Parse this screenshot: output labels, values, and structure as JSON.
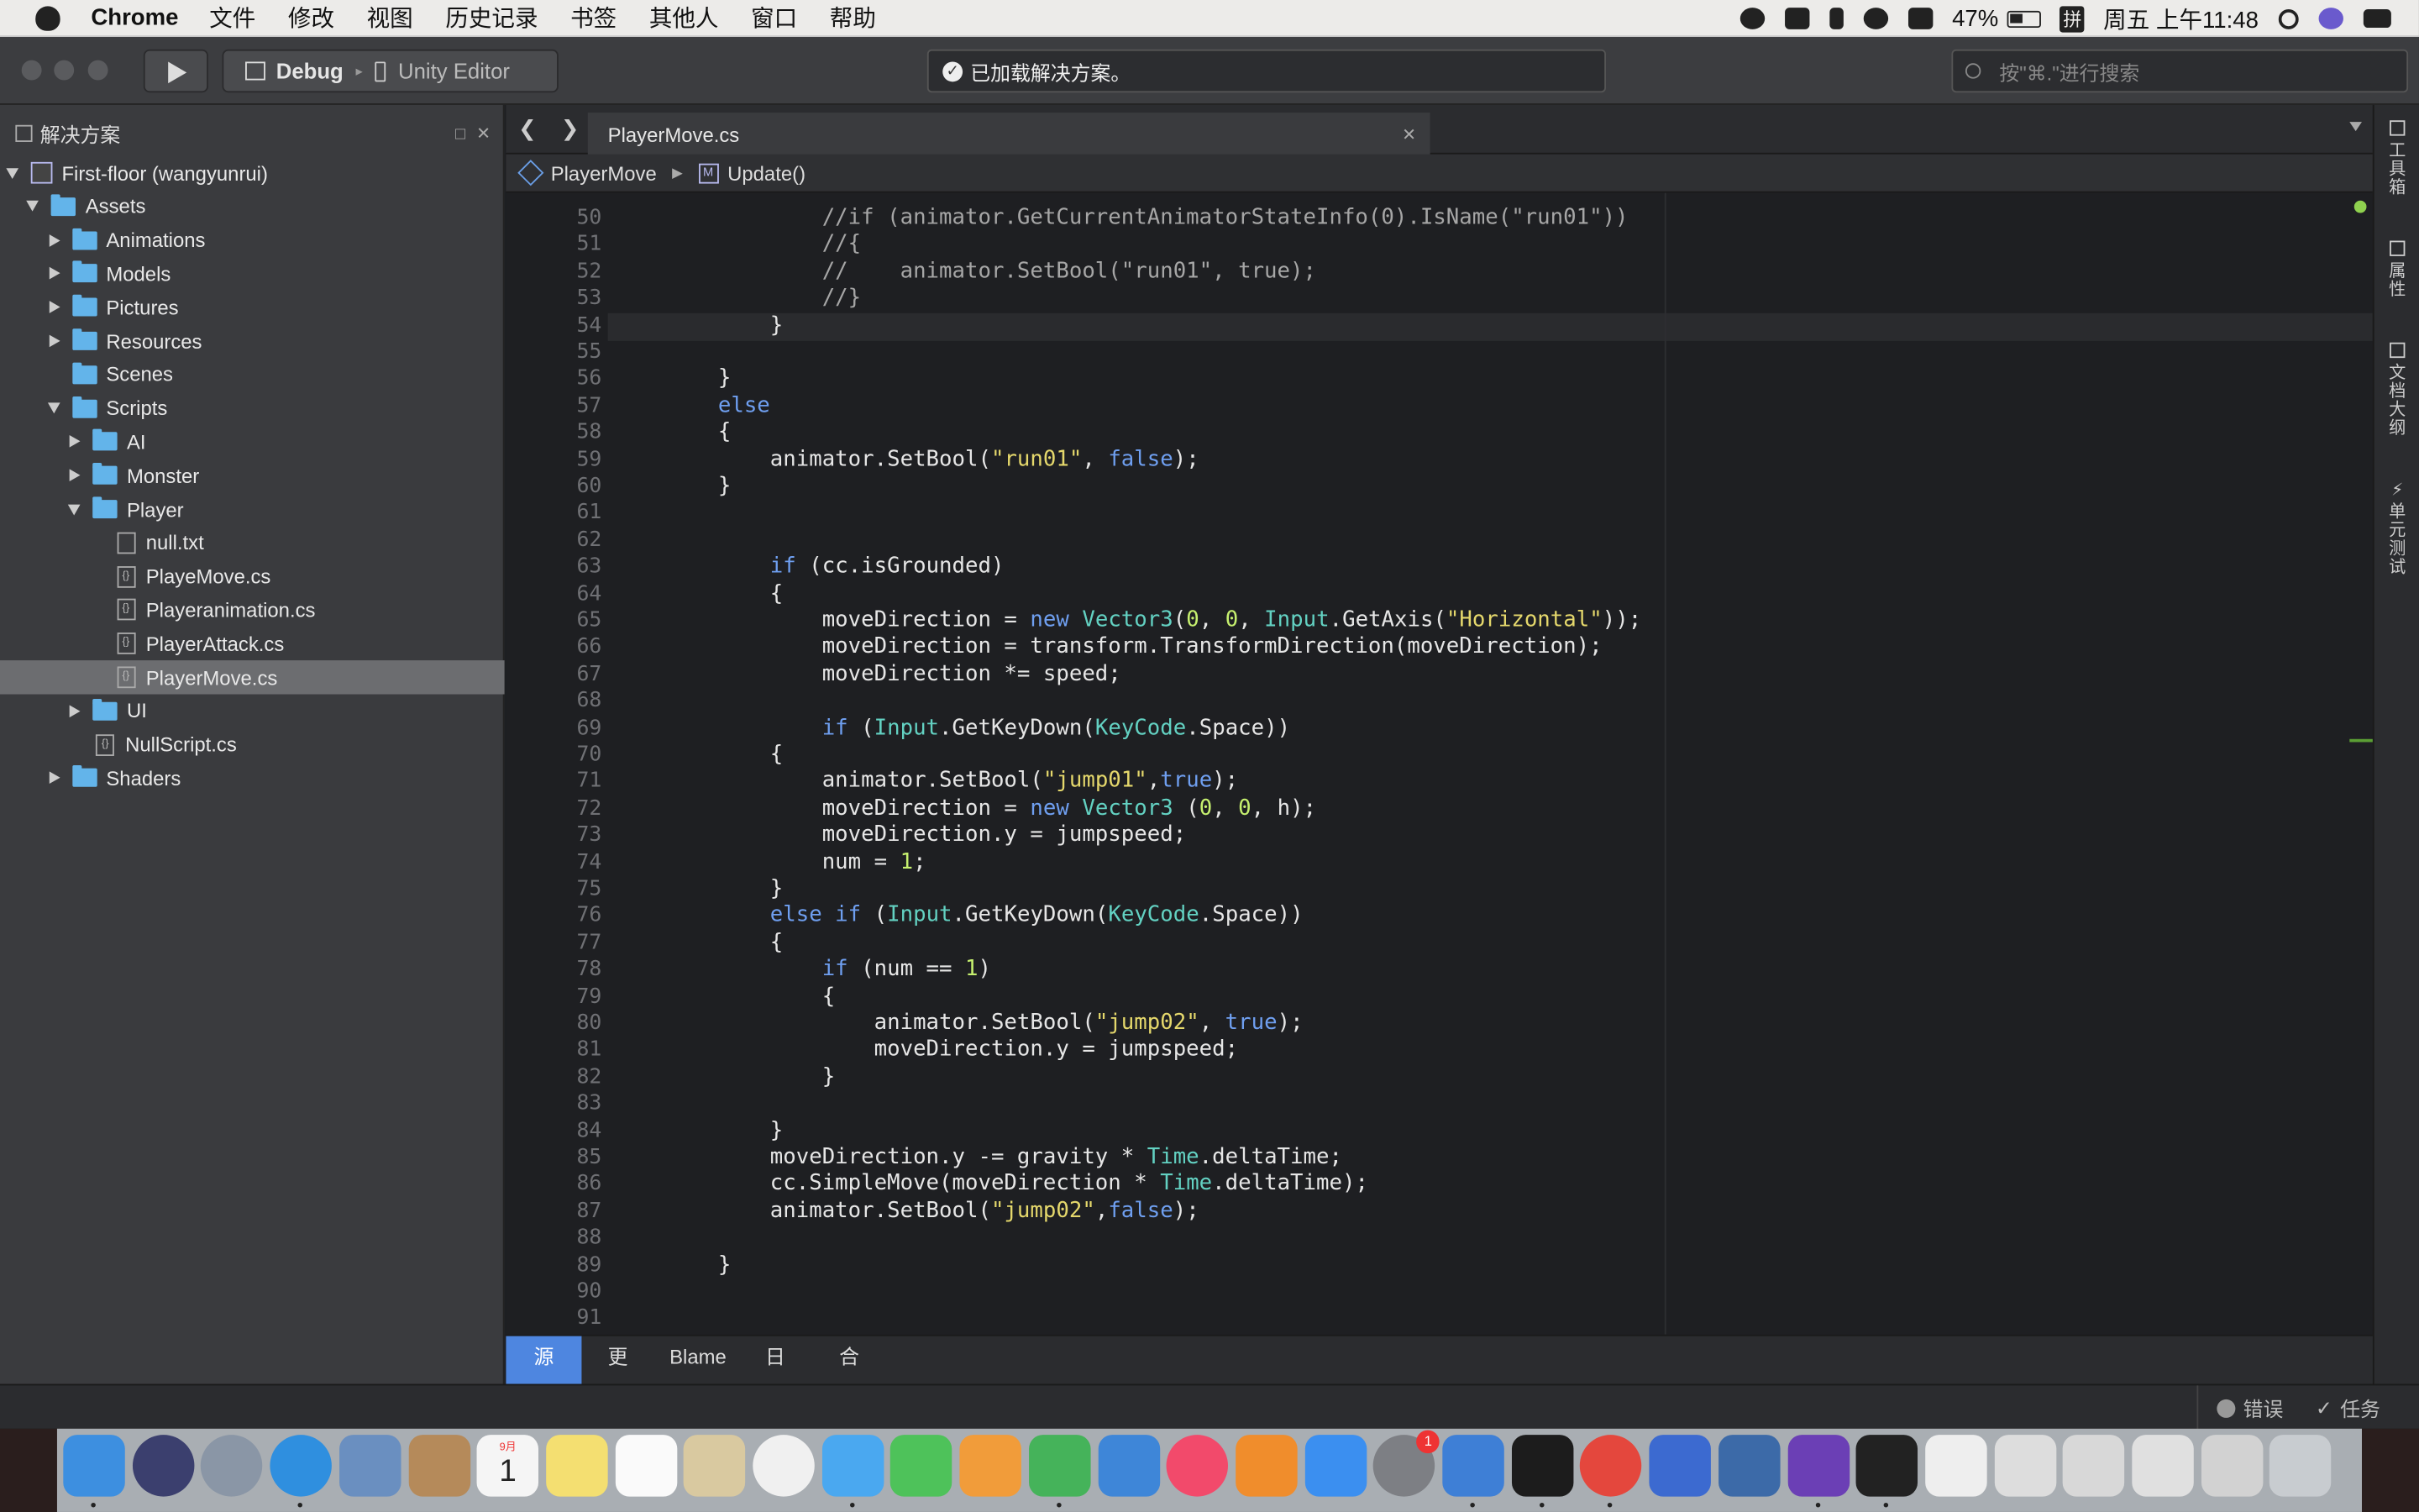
{
  "menubar": {
    "app": "Chrome",
    "items": [
      "文件",
      "修改",
      "视图",
      "历史记录",
      "书签",
      "其他人",
      "窗口",
      "帮助"
    ],
    "battery": "47%",
    "input_method": "拼",
    "clock": "周五 上午11:48"
  },
  "toolbar": {
    "config": "Debug",
    "target": "Unity Editor",
    "status": "已加载解决方案。",
    "search_placeholder": "按\"⌘.\"进行搜索"
  },
  "sidebar": {
    "title": "解决方案",
    "tree": [
      {
        "label": "First-floor (wangyunrui)",
        "depth": 0,
        "kind": "project",
        "toggle": "down"
      },
      {
        "label": "Assets",
        "depth": 1,
        "kind": "folder",
        "toggle": "down"
      },
      {
        "label": "Animations",
        "depth": 2,
        "kind": "folder",
        "toggle": "right"
      },
      {
        "label": "Models",
        "depth": 2,
        "kind": "folder",
        "toggle": "right"
      },
      {
        "label": "Pictures",
        "depth": 2,
        "kind": "folder",
        "toggle": "right"
      },
      {
        "label": "Resources",
        "depth": 2,
        "kind": "folder",
        "toggle": "right"
      },
      {
        "label": "Scenes",
        "depth": 2,
        "kind": "folder",
        "toggle": "none"
      },
      {
        "label": "Scripts",
        "depth": 2,
        "kind": "folder",
        "toggle": "down"
      },
      {
        "label": "AI",
        "depth": 3,
        "kind": "folder",
        "toggle": "right"
      },
      {
        "label": "Monster",
        "depth": 3,
        "kind": "folder",
        "toggle": "right"
      },
      {
        "label": "Player",
        "depth": 3,
        "kind": "folder",
        "toggle": "down"
      },
      {
        "label": "null.txt",
        "depth": 4,
        "kind": "txt",
        "toggle": "none"
      },
      {
        "label": "PlayeMove.cs",
        "depth": 4,
        "kind": "cs",
        "toggle": "none"
      },
      {
        "label": "Playeranimation.cs",
        "depth": 4,
        "kind": "cs",
        "toggle": "none"
      },
      {
        "label": "PlayerAttack.cs",
        "depth": 4,
        "kind": "cs",
        "toggle": "none"
      },
      {
        "label": "PlayerMove.cs",
        "depth": 4,
        "kind": "cs",
        "toggle": "none",
        "selected": true
      },
      {
        "label": "UI",
        "depth": 3,
        "kind": "folder",
        "toggle": "right"
      },
      {
        "label": "NullScript.cs",
        "depth": 3,
        "kind": "cs",
        "toggle": "none"
      },
      {
        "label": "Shaders",
        "depth": 2,
        "kind": "folder",
        "toggle": "right"
      }
    ]
  },
  "editor": {
    "tab": "PlayerMove.cs",
    "crumb_class": "PlayerMove",
    "crumb_method": "Update()",
    "first_line": 50,
    "lines": [
      [
        [
          "cm",
          "                //if (animator.GetCurrentAnimatorStateInfo(0).IsName(\"run01\"))"
        ]
      ],
      [
        [
          "cm",
          "                //{"
        ]
      ],
      [
        [
          "cm",
          "                //    animator.SetBool(\"run01\", true);"
        ]
      ],
      [
        [
          "cm",
          "                //}"
        ]
      ],
      [
        [
          "",
          "            }"
        ]
      ],
      [
        [
          "",
          ""
        ]
      ],
      [
        [
          "",
          "        }"
        ]
      ],
      [
        [
          "kw",
          "        else"
        ]
      ],
      [
        [
          "",
          "        {"
        ]
      ],
      [
        [
          "",
          "            animator.SetBool("
        ],
        [
          "str",
          "\"run01\""
        ],
        [
          "",
          ", "
        ],
        [
          "kw",
          "false"
        ],
        [
          "",
          ");"
        ]
      ],
      [
        [
          "",
          "        }"
        ]
      ],
      [
        [
          "",
          ""
        ]
      ],
      [
        [
          "",
          ""
        ]
      ],
      [
        [
          "kw",
          "            if"
        ],
        [
          "",
          " (cc.isGrounded)"
        ]
      ],
      [
        [
          "",
          "            {"
        ]
      ],
      [
        [
          "",
          "                moveDirection = "
        ],
        [
          "kw",
          "new"
        ],
        [
          "",
          " "
        ],
        [
          "ty",
          "Vector3"
        ],
        [
          "",
          "("
        ],
        [
          "num",
          "0"
        ],
        [
          "",
          ", "
        ],
        [
          "num",
          "0"
        ],
        [
          "",
          ", "
        ],
        [
          "ty",
          "Input"
        ],
        [
          "",
          ".GetAxis("
        ],
        [
          "str",
          "\"Horizontal\""
        ],
        [
          "",
          "));"
        ]
      ],
      [
        [
          "",
          "                moveDirection = transform.TransformDirection(moveDirection);"
        ]
      ],
      [
        [
          "",
          "                moveDirection *= speed;"
        ]
      ],
      [
        [
          "",
          ""
        ]
      ],
      [
        [
          "kw",
          "                if"
        ],
        [
          "",
          " ("
        ],
        [
          "ty",
          "Input"
        ],
        [
          "",
          ".GetKeyDown("
        ],
        [
          "ty",
          "KeyCode"
        ],
        [
          "",
          ".Space))"
        ]
      ],
      [
        [
          "",
          "            {"
        ]
      ],
      [
        [
          "",
          "                animator.SetBool("
        ],
        [
          "str",
          "\"jump01\""
        ],
        [
          "",
          ","
        ],
        [
          "kw",
          "true"
        ],
        [
          "",
          ");"
        ]
      ],
      [
        [
          "",
          "                moveDirection = "
        ],
        [
          "kw",
          "new"
        ],
        [
          "",
          " "
        ],
        [
          "ty",
          "Vector3"
        ],
        [
          "",
          " ("
        ],
        [
          "num",
          "0"
        ],
        [
          "",
          ", "
        ],
        [
          "num",
          "0"
        ],
        [
          "",
          ", h);"
        ]
      ],
      [
        [
          "",
          "                moveDirection.y = jumpspeed;"
        ]
      ],
      [
        [
          "",
          "                num = "
        ],
        [
          "num",
          "1"
        ],
        [
          "",
          ";"
        ]
      ],
      [
        [
          "",
          "            }"
        ]
      ],
      [
        [
          "kw",
          "            else if"
        ],
        [
          "",
          " ("
        ],
        [
          "ty",
          "Input"
        ],
        [
          "",
          ".GetKeyDown("
        ],
        [
          "ty",
          "KeyCode"
        ],
        [
          "",
          ".Space))"
        ]
      ],
      [
        [
          "",
          "            {"
        ]
      ],
      [
        [
          "kw",
          "                if"
        ],
        [
          "",
          " (num == "
        ],
        [
          "num",
          "1"
        ],
        [
          "",
          ")"
        ]
      ],
      [
        [
          "",
          "                {"
        ]
      ],
      [
        [
          "",
          "                    animator.SetBool("
        ],
        [
          "str",
          "\"jump02\""
        ],
        [
          "",
          ", "
        ],
        [
          "kw",
          "true"
        ],
        [
          "",
          ");"
        ]
      ],
      [
        [
          "",
          "                    moveDirection.y = jumpspeed;"
        ]
      ],
      [
        [
          "",
          "                }"
        ]
      ],
      [
        [
          "",
          ""
        ]
      ],
      [
        [
          "",
          "            }"
        ]
      ],
      [
        [
          "",
          "            moveDirection.y -= gravity * "
        ],
        [
          "ty",
          "Time"
        ],
        [
          "",
          ".deltaTime;"
        ]
      ],
      [
        [
          "",
          "            cc.SimpleMove(moveDirection * "
        ],
        [
          "ty",
          "Time"
        ],
        [
          "",
          ".deltaTime);"
        ]
      ],
      [
        [
          "",
          "            animator.SetBool("
        ],
        [
          "str",
          "\"jump02\""
        ],
        [
          "",
          ","
        ],
        [
          "kw",
          "false"
        ],
        [
          "",
          ");"
        ]
      ],
      [
        [
          "",
          ""
        ]
      ],
      [
        [
          "",
          "        }"
        ]
      ],
      [
        [
          "",
          ""
        ]
      ],
      [
        [
          "",
          ""
        ]
      ]
    ]
  },
  "right_panel": [
    "工具箱",
    "属性",
    "文档大纲",
    "单元测试"
  ],
  "bottom_tabs": [
    "源",
    "更改",
    "Blame",
    "日志",
    "合并"
  ],
  "statusbar": {
    "errors": "错误",
    "tasks": "任务"
  },
  "dock": {
    "calendar_month": "9月",
    "calendar_day": "1",
    "badge": "1",
    "icons": [
      {
        "name": "finder-icon",
        "color": "#3d8fe0"
      },
      {
        "name": "siri-icon",
        "color": "#3b3f6e"
      },
      {
        "name": "launchpad-icon",
        "color": "#8a96a6"
      },
      {
        "name": "safari-icon",
        "color": "#2f8fdf"
      },
      {
        "name": "eagle-icon",
        "color": "#6a8fc0"
      },
      {
        "name": "contacts-icon",
        "color": "#b58a5a"
      },
      {
        "name": "calendar-icon",
        "color": "#f5f5f5"
      },
      {
        "name": "notes-icon",
        "color": "#f4df71"
      },
      {
        "name": "reminders-icon",
        "color": "#fafafa"
      },
      {
        "name": "preview-icon",
        "color": "#d9c9a0"
      },
      {
        "name": "photos-icon",
        "color": "#f0f0f0"
      },
      {
        "name": "messages-icon",
        "color": "#4aa8f0"
      },
      {
        "name": "facetime-icon",
        "color": "#4ec25a"
      },
      {
        "name": "pages-icon",
        "color": "#f19c3a"
      },
      {
        "name": "numbers-icon",
        "color": "#45b35a"
      },
      {
        "name": "keynote-icon",
        "color": "#3e86d8"
      },
      {
        "name": "music-icon",
        "color": "#f24a6b"
      },
      {
        "name": "books-icon",
        "color": "#f08d2c"
      },
      {
        "name": "appstore-icon",
        "color": "#3b8ff0"
      },
      {
        "name": "system-prefs-icon",
        "color": "#7d7f84"
      },
      {
        "name": "xcode-icon",
        "color": "#3e7fd6"
      },
      {
        "name": "qq-icon",
        "color": "#1c1c1c"
      },
      {
        "name": "chrome-icon",
        "color": "#e4473d"
      },
      {
        "name": "instruments-icon",
        "color": "#3c6ad0"
      },
      {
        "name": "sourcetree-icon",
        "color": "#3c6aa8"
      },
      {
        "name": "visual-studio-icon",
        "color": "#6b3fb5"
      },
      {
        "name": "unity-icon",
        "color": "#222222"
      },
      {
        "name": "file-icon",
        "color": "#eeeeee"
      },
      {
        "name": "window-thumb-1-icon",
        "color": "#dddddd"
      },
      {
        "name": "window-thumb-2-icon",
        "color": "#d8d8d8"
      },
      {
        "name": "window-thumb-3-icon",
        "color": "#e0e0e0"
      },
      {
        "name": "window-thumb-4-icon",
        "color": "#d2d2d2"
      },
      {
        "name": "trash-icon",
        "color": "#c8ccd0"
      }
    ]
  }
}
